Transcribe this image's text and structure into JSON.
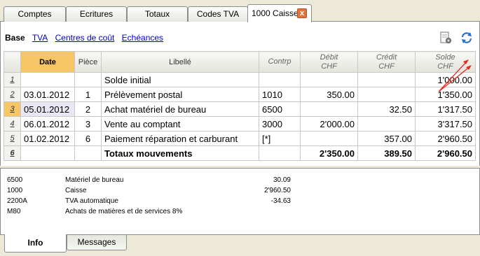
{
  "tabs": [
    {
      "label": "Comptes"
    },
    {
      "label": "Ecritures"
    },
    {
      "label": "Totaux"
    },
    {
      "label": "Codes TVA"
    },
    {
      "label": "1000 Caisse"
    }
  ],
  "close_label": "x",
  "subnav": {
    "active": "Base",
    "links": [
      "TVA",
      "Centres de coût",
      "Echéances"
    ]
  },
  "columns": {
    "date": "Date",
    "piece": "Pièce",
    "libelle": "Libellé",
    "contrp": "Contrp",
    "debit": "Débit",
    "debit_unit": "CHF",
    "credit": "Crédit",
    "credit_unit": "CHF",
    "solde": "Solde",
    "solde_unit": "CHF"
  },
  "rows": [
    {
      "n": "1",
      "date": "",
      "piece": "",
      "libelle": "Solde initial",
      "contrp": "",
      "debit": "",
      "credit": "",
      "solde": "1'000.00"
    },
    {
      "n": "2",
      "date": "03.01.2012",
      "piece": "1",
      "libelle": "Prélèvement postal",
      "contrp": "1010",
      "debit": "350.00",
      "credit": "",
      "solde": "1'350.00"
    },
    {
      "n": "3",
      "date": "05.01.2012",
      "piece": "2",
      "libelle": "Achat matériel de bureau",
      "contrp": "6500",
      "debit": "",
      "credit": "32.50",
      "solde": "1'317.50"
    },
    {
      "n": "4",
      "date": "06.01.2012",
      "piece": "3",
      "libelle": "Vente au comptant",
      "contrp": "3000",
      "debit": "2'000.00",
      "credit": "",
      "solde": "3'317.50"
    },
    {
      "n": "5",
      "date": "01.02.2012",
      "piece": "6",
      "libelle": "Paiement réparation et carburant",
      "contrp": "[*]",
      "debit": "",
      "credit": "357.00",
      "solde": "2'960.50"
    },
    {
      "n": "6",
      "date": "",
      "piece": "",
      "libelle": "Totaux  mouvements",
      "contrp": "",
      "debit": "2'350.00",
      "credit": "389.50",
      "solde": "2'960.50"
    }
  ],
  "info": [
    {
      "acct": "6500",
      "desc": "Matériel de bureau",
      "amt": "30.09"
    },
    {
      "acct": "1000",
      "desc": "Caisse",
      "amt": "2'960.50"
    },
    {
      "acct": "2200A",
      "desc": "TVA automatique",
      "amt": "-34.63"
    },
    {
      "acct": "M80",
      "desc": "Achats de matières et de services 8%",
      "amt": ""
    }
  ],
  "bottom_tabs": [
    {
      "label": "Info"
    },
    {
      "label": "Messages"
    }
  ],
  "colors": {
    "selected_header": "#f5c566",
    "close_button": "#e0743c",
    "link": "#0000cc",
    "annotation": "#e8281e"
  },
  "icons": {
    "doc_settings": "document-gear-icon",
    "recalc": "recalculate-icon"
  }
}
